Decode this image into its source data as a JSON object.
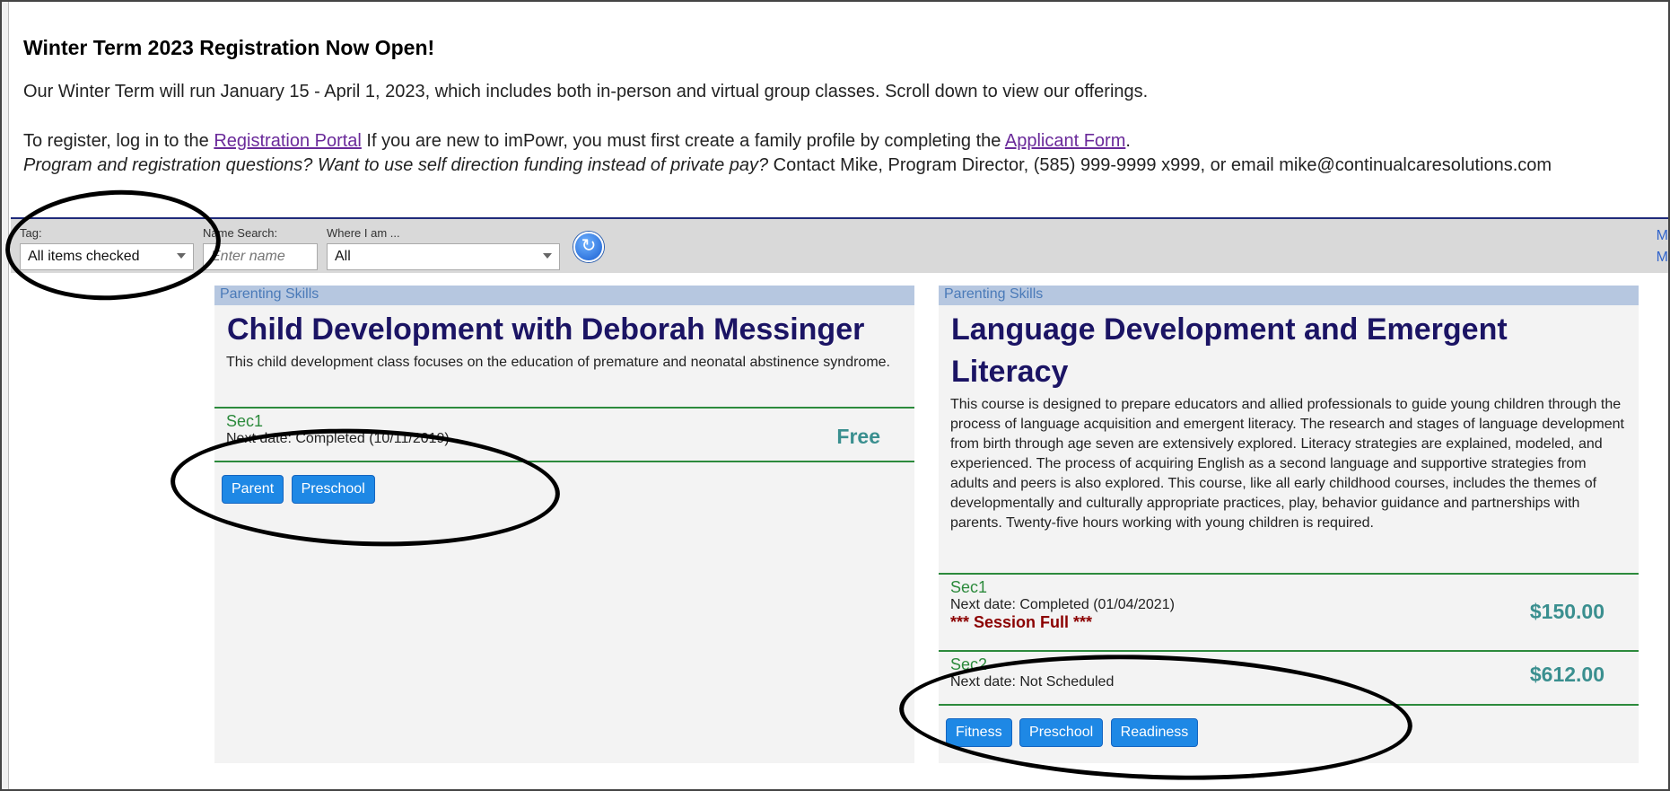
{
  "intro": {
    "heading": "Winter Term 2023 Registration Now Open!",
    "line1": "Our Winter Term will run January 15 - April 1, 2023, which includes both in-person and virtual group classes. Scroll down to view our offerings.",
    "register_prefix": "To register, log in to the ",
    "portal_link": "Registration Portal",
    "register_middle": "  If you are new to imPowr, you must first create a family profile by completing the ",
    "applicant_link": "Applicant Form",
    "register_suffix": ".",
    "question_italic": "Program and registration questions? Want to use self direction funding instead of private pay?",
    "contact": " Contact Mike, Program Director, (585) 999-9999 x999, or email  mike@continualcaresolutions.com"
  },
  "filters": {
    "tag_label": "Tag:",
    "tag_value": "All items checked",
    "name_label": "Name Search:",
    "name_placeholder": "Enter name",
    "where_label": "Where I am ...",
    "where_value": "All",
    "refresh_icon": "refresh-icon",
    "edge_link_1": "M",
    "edge_link_2": "M"
  },
  "courses": [
    {
      "category": "Parenting Skills",
      "title": "Child Development with Deborah Messinger",
      "description": "This child development class focuses on the education of premature and neonatal abstinence syndrome.",
      "sections": [
        {
          "name": "Sec1",
          "next_date": "Next date: Completed (10/11/2019)",
          "price": "Free"
        }
      ],
      "tags": [
        "Parent",
        "Preschool"
      ]
    },
    {
      "category": "Parenting Skills",
      "title": "Language Development and Emergent Literacy",
      "description": "This course is designed to prepare educators and allied professionals to guide young children through the process of language acquisition and emergent literacy. The research and stages of language development from birth through age seven are extensively explored. Literacy strategies are explained, modeled, and experienced. The process of acquiring English as a second language and supportive strategies from adults and peers is also explored. This course, like all early childhood courses, includes the themes of developmentally and culturally appropriate practices, play, behavior guidance and partnerships with parents. Twenty-five hours working with young children is required.",
      "sections": [
        {
          "name": "Sec1",
          "next_date": "Next date: Completed (01/04/2021)",
          "status": "*** Session Full ***",
          "price": "$150.00"
        },
        {
          "name": "Sec2",
          "next_date": "Next date: Not Scheduled",
          "price": "$612.00"
        }
      ],
      "tags": [
        "Fitness",
        "Preschool",
        "Readiness"
      ]
    }
  ]
}
